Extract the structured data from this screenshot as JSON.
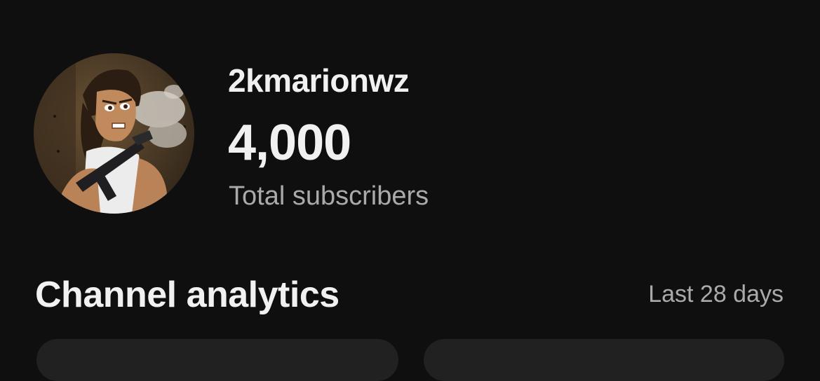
{
  "channel": {
    "name": "2kmarionwz",
    "subscriber_count": "4,000",
    "subscriber_label": "Total subscribers",
    "avatar_icon": "channel-avatar"
  },
  "analytics": {
    "title": "Channel analytics",
    "date_range": "Last 28 days"
  },
  "colors": {
    "background": "#0f0f0f",
    "primary_text": "#f1f1f1",
    "secondary_text": "#aaaaaa",
    "card": "#212121"
  }
}
